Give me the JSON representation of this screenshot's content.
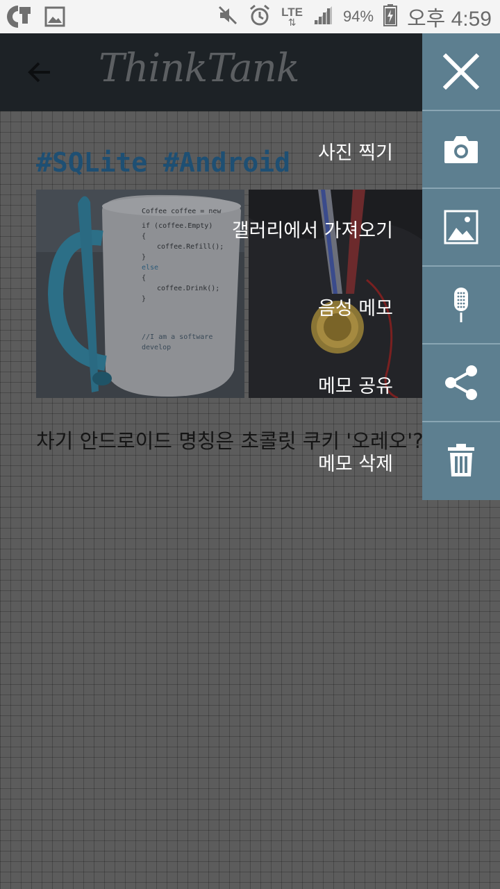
{
  "status_bar": {
    "battery": "94%",
    "network": "LTE",
    "time": "오후 4:59"
  },
  "app": {
    "title": "ThinkTank"
  },
  "note": {
    "tags": "#SQLite #Android",
    "body": "차기 안드로이드 명칭은 초콜릿 쿠키 '오레오'?",
    "photo1": {
      "code_lines": [
        "Coffee coffee = new",
        "if (coffee.Empty)",
        "{",
        "coffee.Refill();",
        "}",
        "else",
        "{",
        "coffee.Drink();",
        "}",
        "//I am a software develop"
      ]
    }
  },
  "menu": {
    "items": [
      {
        "label": "",
        "icon": "close-icon"
      },
      {
        "label": "사진 찍기",
        "icon": "camera-icon"
      },
      {
        "label": "갤러리에서 가져오기",
        "icon": "gallery-icon"
      },
      {
        "label": "음성 메모",
        "icon": "microphone-icon"
      },
      {
        "label": "메모 공유",
        "icon": "share-icon"
      },
      {
        "label": "메모 삭제",
        "icon": "trash-icon"
      }
    ]
  },
  "colors": {
    "appbar": "#1d2226",
    "menu_panel": "#5d7f90",
    "tag_text": "#1e4f73"
  }
}
